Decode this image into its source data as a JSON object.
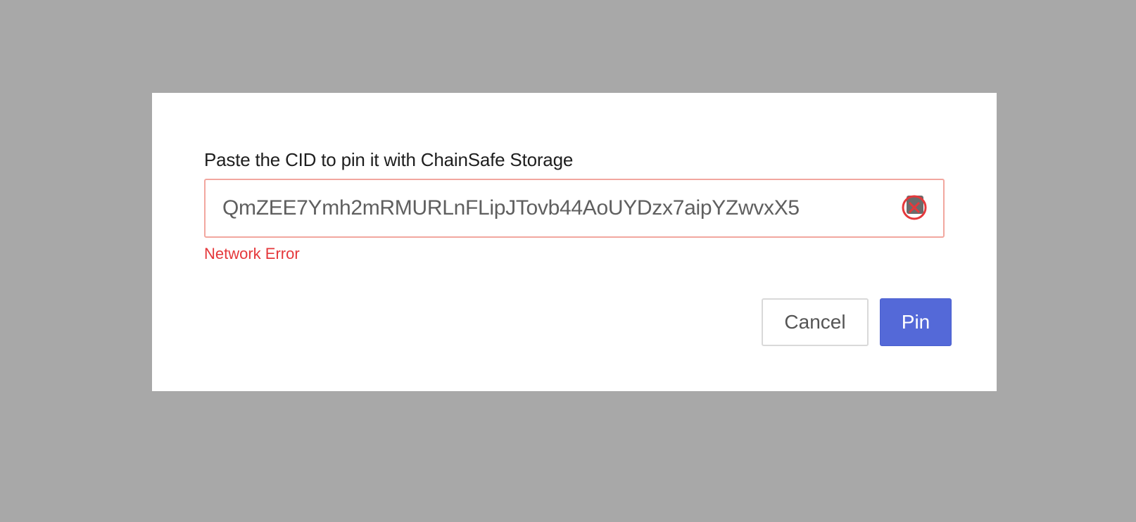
{
  "modal": {
    "label": "Paste the CID to pin it with ChainSafe Storage",
    "cid_input": {
      "value": "QmZEE7Ymh2mRMURLnFLipJTovb44AoUYDzx7aipYZwvxX5",
      "placeholder": ""
    },
    "error_icon": "error-circle-x-icon",
    "error_message": "Network Error",
    "cancel_label": "Cancel",
    "pin_label": "Pin"
  },
  "colors": {
    "primary": "#5469d8",
    "error": "#e5383b",
    "error_border": "#f2a79f",
    "overlay": "#a8a8a8"
  }
}
